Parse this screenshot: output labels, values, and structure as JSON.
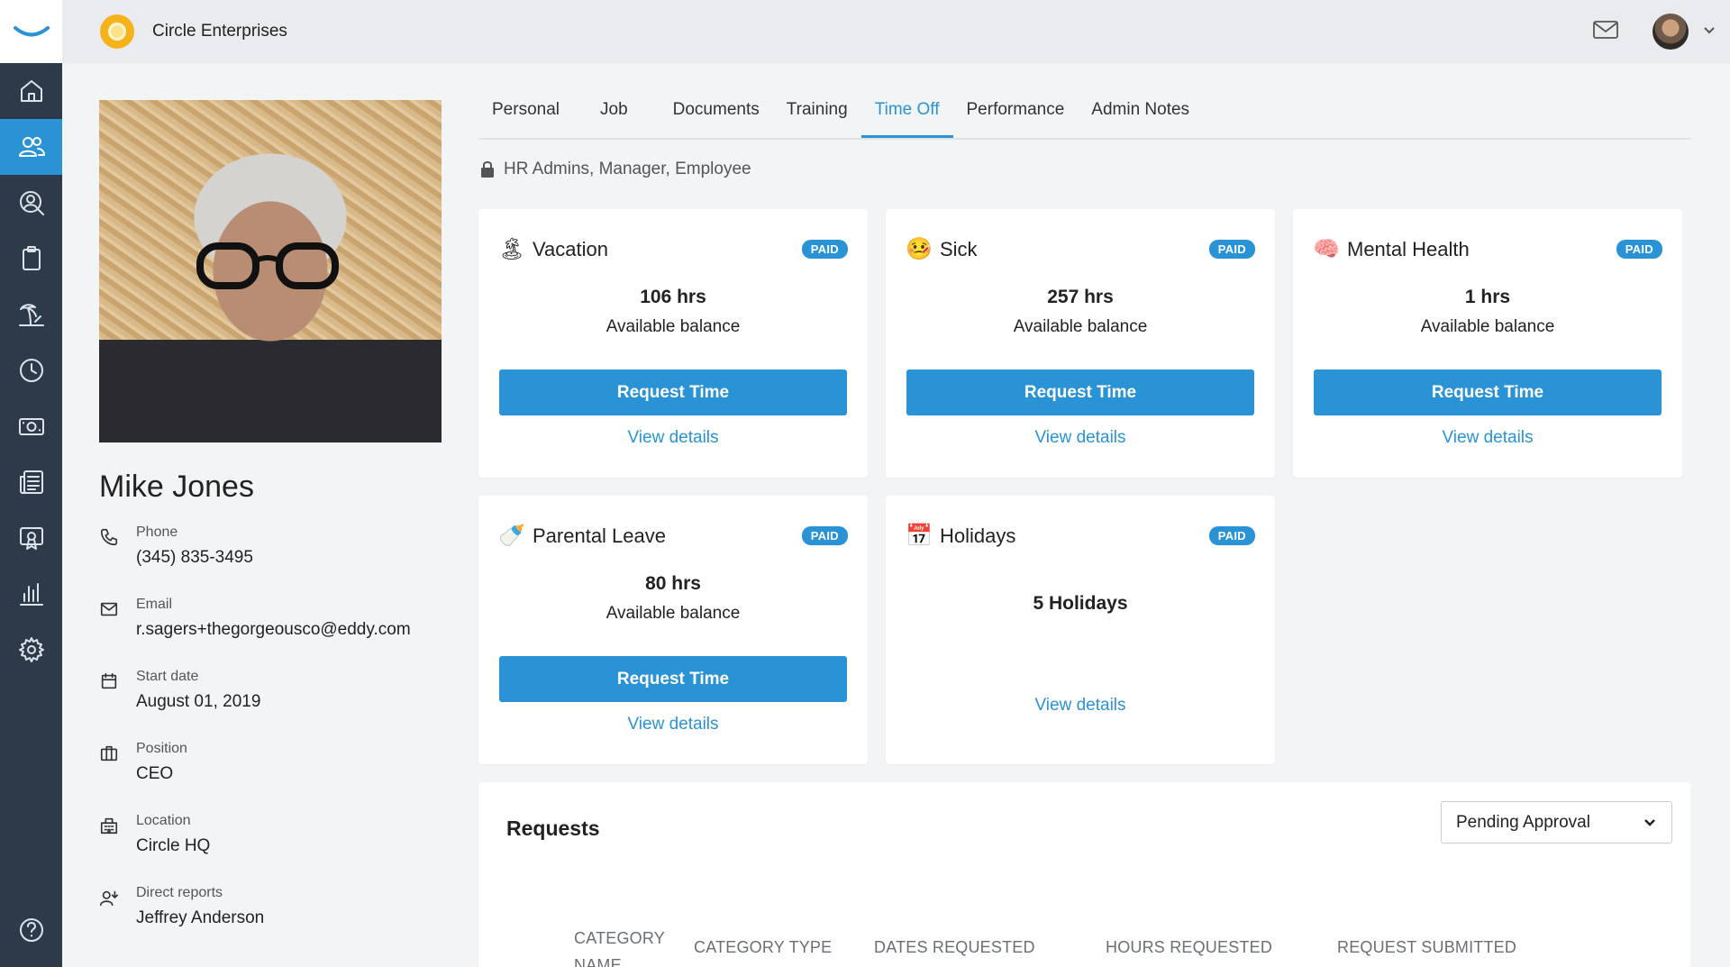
{
  "app": {
    "company_name": "Circle Enterprises",
    "accent_color": "#2a93d5"
  },
  "sidebar": {
    "items": [
      {
        "icon": "home-icon"
      },
      {
        "icon": "people-icon",
        "active": true
      },
      {
        "icon": "user-search-icon"
      },
      {
        "icon": "clipboard-icon"
      },
      {
        "icon": "beach-icon"
      },
      {
        "icon": "clock-icon"
      },
      {
        "icon": "money-icon"
      },
      {
        "icon": "news-icon"
      },
      {
        "icon": "certificate-icon"
      },
      {
        "icon": "bar-chart-icon"
      },
      {
        "icon": "gear-icon"
      }
    ],
    "help_icon": "help-icon"
  },
  "profile": {
    "name": "Mike Jones",
    "fields": [
      {
        "icon": "phone-icon",
        "label": "Phone",
        "value": "(345) 835-3495"
      },
      {
        "icon": "mail-icon",
        "label": "Email",
        "value": "r.sagers+thegorgeousco@eddy.com"
      },
      {
        "icon": "calendar-icon",
        "label": "Start date",
        "value": "August 01, 2019"
      },
      {
        "icon": "briefcase-icon",
        "label": "Position",
        "value": "CEO"
      },
      {
        "icon": "building-icon",
        "label": "Location",
        "value": "Circle HQ"
      },
      {
        "icon": "direct-reports-icon",
        "label": "Direct reports",
        "value": "Jeffrey Anderson"
      }
    ]
  },
  "tabs": [
    "Personal",
    "Job",
    "Documents",
    "Training",
    "Time Off",
    "Performance",
    "Admin Notes"
  ],
  "active_tab": "Time Off",
  "permissions": "HR Admins, Manager, Employee",
  "cards": [
    {
      "emoji": "🏝",
      "title": "Vacation",
      "badge": "PAID",
      "hours": "106 hrs",
      "avail": "Available balance",
      "button": "Request Time",
      "details": "View details"
    },
    {
      "emoji": "🤒",
      "title": "Sick",
      "badge": "PAID",
      "hours": "257 hrs",
      "avail": "Available balance",
      "button": "Request Time",
      "details": "View details"
    },
    {
      "emoji": "🧠",
      "title": "Mental Health",
      "badge": "PAID",
      "hours": "1 hrs",
      "avail": "Available balance",
      "button": "Request Time",
      "details": "View details"
    },
    {
      "emoji": "🍼",
      "title": "Parental Leave",
      "badge": "PAID",
      "hours": "80 hrs",
      "avail": "Available balance",
      "button": "Request Time",
      "details": "View details"
    },
    {
      "emoji": "📅",
      "title": "Holidays",
      "badge": "PAID",
      "count": "5 Holidays",
      "details": "View details"
    }
  ],
  "requests": {
    "title": "Requests",
    "filter": "Pending Approval",
    "columns": [
      "CATEGORY NAME",
      "CATEGORY TYPE",
      "DATES REQUESTED",
      "HOURS REQUESTED",
      "REQUEST SUBMITTED"
    ]
  }
}
